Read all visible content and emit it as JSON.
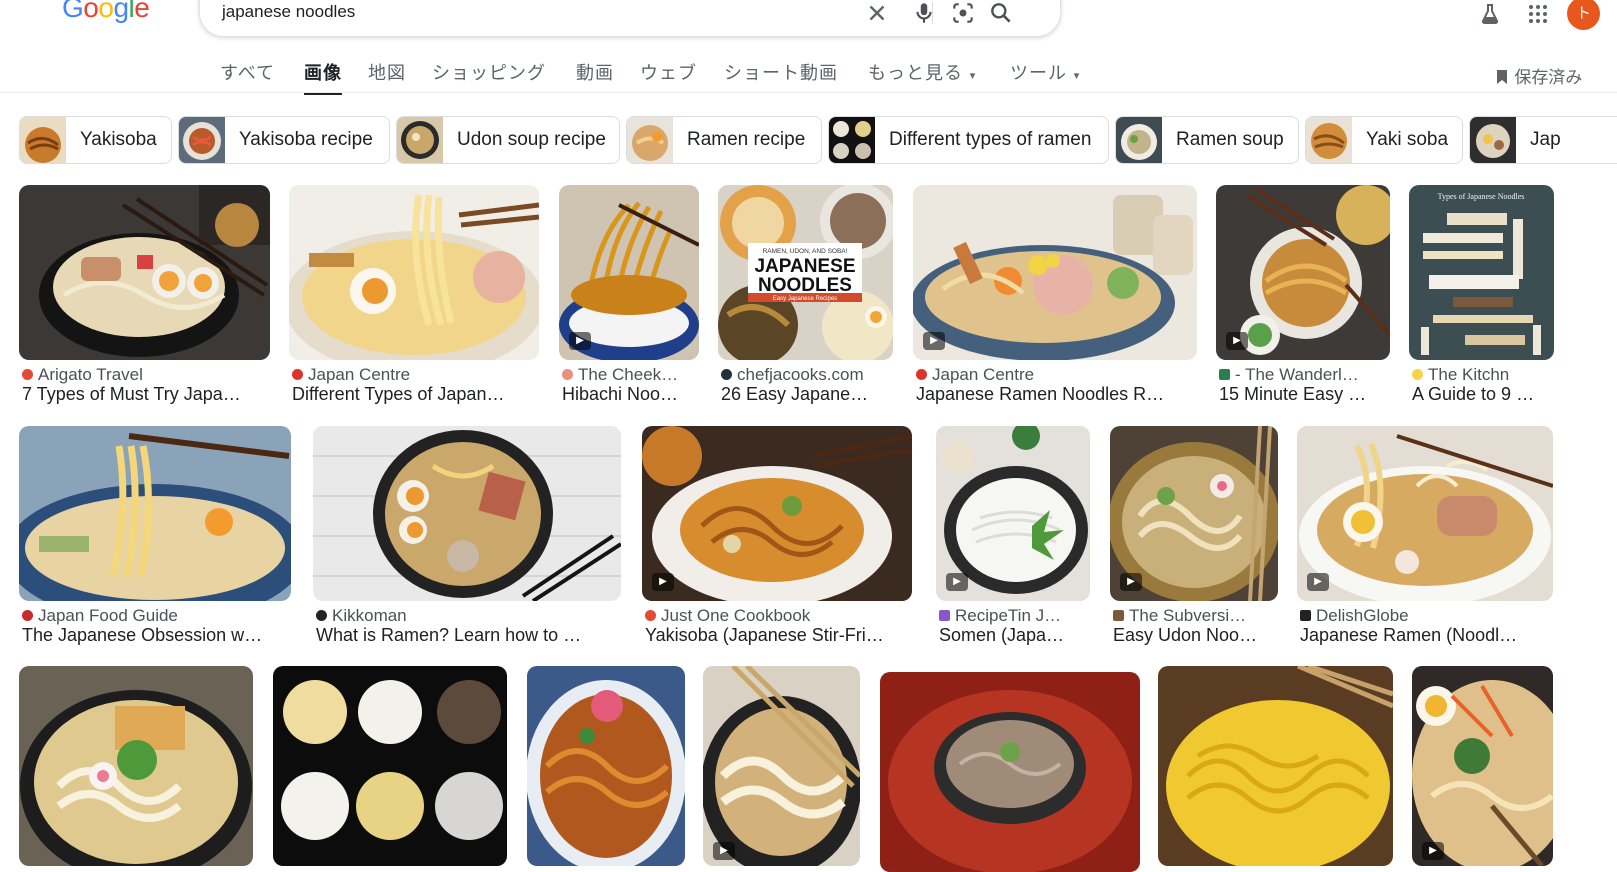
{
  "logo": "Google",
  "search": {
    "query": "japanese noodles"
  },
  "tabs": [
    "すべて",
    "画像",
    "地図",
    "ショッピング",
    "動画",
    "ウェブ",
    "ショート動画",
    "もっと見る",
    "ツール"
  ],
  "active_tab": "画像",
  "saved_label": "保存済み",
  "avatar_letter": "ト",
  "colors": {
    "accent": "#e8581e",
    "text": "#202124",
    "muted": "#5f6368"
  },
  "chips": [
    "Yakisoba",
    "Yakisoba recipe",
    "Udon soup recipe",
    "Ramen recipe",
    "Different types of ramen",
    "Ramen soup",
    "Yaki soba",
    "Jap"
  ],
  "results": [
    {
      "source": "Arigato Travel",
      "title": "7 Types of Must Try Japa…",
      "video": false
    },
    {
      "source": "Japan Centre",
      "title": "Different Types of Japan…",
      "video": false
    },
    {
      "source": "The Cheek…",
      "title": "Hibachi Noo…",
      "video": true
    },
    {
      "source": "chefjacooks.com",
      "title": "26 Easy Japane…",
      "video": false
    },
    {
      "source": "Japan Centre",
      "title": "Japanese Ramen Noodles R…",
      "video": true
    },
    {
      "source": "- The Wanderl…",
      "title": "15 Minute Easy …",
      "video": true
    },
    {
      "source": "The Kitchn",
      "title": "A Guide to 9 …",
      "video": false
    },
    {
      "source": "Japan Food Guide",
      "title": "The Japanese Obsession w…",
      "video": false
    },
    {
      "source": "Kikkoman",
      "title": "What is Ramen? Learn how to …",
      "video": false
    },
    {
      "source": "Just One Cookbook",
      "title": "Yakisoba (Japanese Stir-Fri…",
      "video": true
    },
    {
      "source": "RecipeTin J…",
      "title": "Somen (Japa…",
      "video": true
    },
    {
      "source": "The Subversi…",
      "title": "Easy Udon Noo…",
      "video": true
    },
    {
      "source": "DelishGlobe",
      "title": "Japanese Ramen (Noodl…",
      "video": true
    },
    {
      "source": "",
      "title": "",
      "video": false
    },
    {
      "source": "",
      "title": "",
      "video": false
    },
    {
      "source": "",
      "title": "",
      "video": false
    },
    {
      "source": "",
      "title": "",
      "video": true
    },
    {
      "source": "",
      "title": "",
      "video": false
    },
    {
      "source": "",
      "title": "",
      "video": false
    },
    {
      "source": "",
      "title": "",
      "video": true
    }
  ],
  "overlay_text": {
    "cookbook_line1": "RAMEN, UDON, AND SOBA!",
    "cookbook_line2": "JAPANESE",
    "cookbook_line3": "NOODLES",
    "cookbook_line4": "Easy Japanese Recipes",
    "kitchn_title": "Types of Japanese Noodles"
  }
}
